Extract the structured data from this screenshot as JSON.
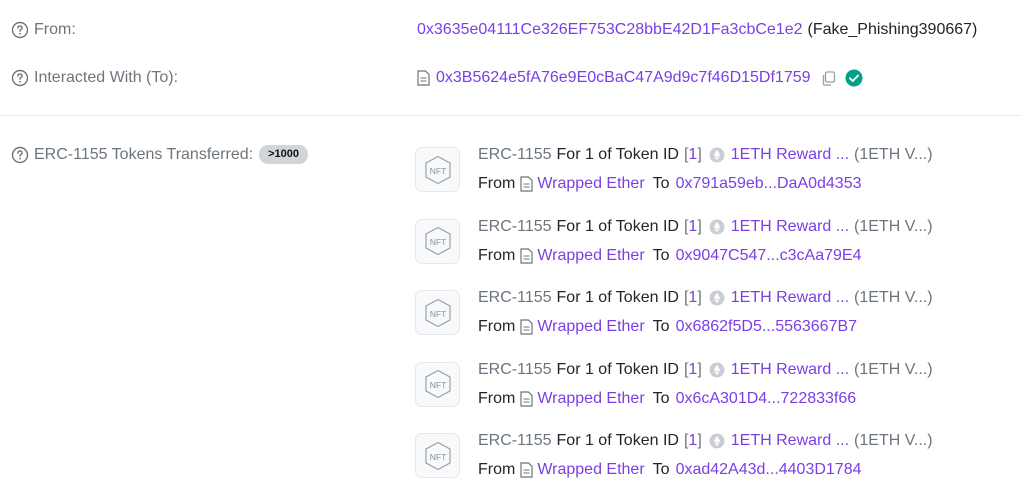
{
  "from_row": {
    "label": "From:",
    "address": "0x3635e04111Ce326EF753C28bbE42D1Fa3cbCe1e2",
    "tag": "(Fake_Phishing390667)"
  },
  "to_row": {
    "label": "Interacted With (To):",
    "address": "0x3B5624e5fA76e9E0cBaC47A9d9c7f46D15Df1759"
  },
  "tokens_row": {
    "label": "ERC-1155 Tokens Transferred:",
    "count_badge": ">1000"
  },
  "transfers": [
    {
      "standard": "ERC-1155",
      "for_text": "For 1 of Token ID",
      "bracket_open": "[",
      "token_id": "1",
      "bracket_close": "]",
      "token_name": "1ETH Reward ...",
      "token_symbol": "(1ETH V...)",
      "from_label": "From",
      "from_name": "Wrapped Ether",
      "to_label": "To",
      "to_address": "0x791a59eb...DaA0d4353"
    },
    {
      "standard": "ERC-1155",
      "for_text": "For 1 of Token ID",
      "bracket_open": "[",
      "token_id": "1",
      "bracket_close": "]",
      "token_name": "1ETH Reward ...",
      "token_symbol": "(1ETH V...)",
      "from_label": "From",
      "from_name": "Wrapped Ether",
      "to_label": "To",
      "to_address": "0x9047C547...c3cAa79E4"
    },
    {
      "standard": "ERC-1155",
      "for_text": "For 1 of Token ID",
      "bracket_open": "[",
      "token_id": "1",
      "bracket_close": "]",
      "token_name": "1ETH Reward ...",
      "token_symbol": "(1ETH V...)",
      "from_label": "From",
      "from_name": "Wrapped Ether",
      "to_label": "To",
      "to_address": "0x6862f5D5...5563667B7"
    },
    {
      "standard": "ERC-1155",
      "for_text": "For 1 of Token ID",
      "bracket_open": "[",
      "token_id": "1",
      "bracket_close": "]",
      "token_name": "1ETH Reward ...",
      "token_symbol": "(1ETH V...)",
      "from_label": "From",
      "from_name": "Wrapped Ether",
      "to_label": "To",
      "to_address": "0x6cA301D4...722833f66"
    },
    {
      "standard": "ERC-1155",
      "for_text": "For 1 of Token ID",
      "bracket_open": "[",
      "token_id": "1",
      "bracket_close": "]",
      "token_name": "1ETH Reward ...",
      "token_symbol": "(1ETH V...)",
      "from_label": "From",
      "from_name": "Wrapped Ether",
      "to_label": "To",
      "to_address": "0xad42A43d...4403D1784"
    }
  ],
  "nft_placeholder_text": "NFT",
  "icons": {
    "help": "question-circle-icon",
    "contract": "document-icon",
    "copy": "copy-icon",
    "verified": "check-circle-icon",
    "token": "ethereum-icon",
    "nft": "nft-hexagon-icon"
  },
  "colors": {
    "link": "#7b3fe4",
    "verified": "#00a186",
    "label": "#6c757d",
    "badge_bg": "#d1d5da"
  }
}
